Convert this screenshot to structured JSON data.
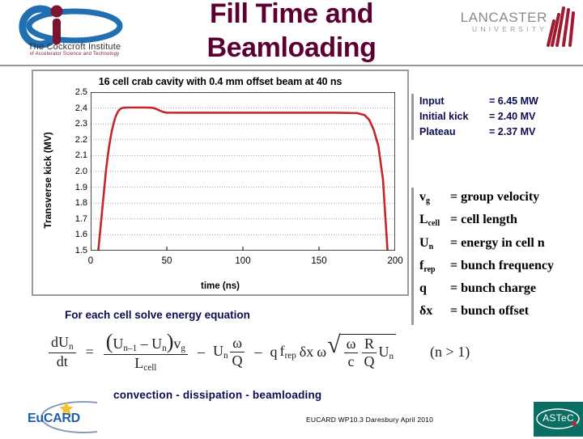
{
  "header": {
    "title": "Fill Time and Beamloading",
    "title_color": "#5C0033",
    "cockcroft": {
      "name": "The Cockcroft Institute",
      "tagline": "of Accelerator Science and Technology"
    },
    "lancaster": {
      "name": "LANCASTER",
      "sub": "UNIVERSITY"
    }
  },
  "chart_data": {
    "type": "line",
    "title": "16 cell crab cavity with 0.4 mm offset beam at 40 ns",
    "xlabel": "time (ns)",
    "ylabel": "Transverse kick (MV)",
    "xlim": [
      0,
      200
    ],
    "ylim": [
      1.5,
      2.5
    ],
    "xticks": [
      "0",
      "50",
      "100",
      "150",
      "200"
    ],
    "xtick_values": [
      0,
      50,
      100,
      150,
      200
    ],
    "yticks": [
      "1.5",
      "1.6",
      "1.7",
      "1.8",
      "1.9",
      "2.0",
      "2.1",
      "2.2",
      "2.3",
      "2.4",
      "2.5"
    ],
    "ytick_values": [
      1.5,
      1.6,
      1.7,
      1.8,
      1.9,
      2.0,
      2.1,
      2.2,
      2.3,
      2.4,
      2.5
    ],
    "grid": true,
    "legend": null,
    "series": [
      {
        "name": "Transverse kick",
        "color": "#C3272B",
        "x": [
          5,
          6,
          7,
          8,
          9,
          10,
          11,
          12,
          13,
          14,
          15,
          16,
          17,
          18,
          19,
          20,
          22,
          25,
          30,
          35,
          40,
          42,
          44,
          46,
          48,
          50,
          60,
          80,
          100,
          120,
          140,
          160,
          175,
          180,
          183,
          186,
          189,
          192,
          195
        ],
        "y": [
          1.5,
          1.6,
          1.7,
          1.8,
          1.9,
          2.0,
          2.08,
          2.15,
          2.21,
          2.26,
          2.3,
          2.335,
          2.36,
          2.378,
          2.39,
          2.398,
          2.402,
          2.403,
          2.403,
          2.403,
          2.402,
          2.398,
          2.39,
          2.381,
          2.374,
          2.371,
          2.37,
          2.37,
          2.37,
          2.37,
          2.37,
          2.37,
          2.368,
          2.355,
          2.325,
          2.26,
          2.16,
          1.95,
          1.5
        ]
      }
    ]
  },
  "results": {
    "rows": [
      {
        "name": "Input",
        "value": "= 6.45 MW"
      },
      {
        "name": "Initial kick",
        "value": "= 2.40 MV"
      },
      {
        "name": "Plateau",
        "value": "= 2.37 MV"
      }
    ]
  },
  "symbols": {
    "rows": [
      {
        "sym": "v",
        "sub": "g",
        "desc": "= group velocity"
      },
      {
        "sym": "L",
        "sub": "cell",
        "desc": "= cell length"
      },
      {
        "sym": "U",
        "sub": "n",
        "desc": "= energy in cell n"
      },
      {
        "sym": "f",
        "sub": "rep",
        "desc": "= bunch frequency"
      },
      {
        "sym": "q",
        "sub": "",
        "desc": "= bunch charge"
      },
      {
        "sym": "δx",
        "sub": "",
        "desc": "= bunch offset"
      }
    ]
  },
  "equation": {
    "solve_label": "For each cell solve energy equation",
    "terms_label": "convection  -  dissipation  -   beamloading",
    "lhs_num": "dU",
    "lhs_num_sub": "n",
    "lhs_den": "dt",
    "equals": "=",
    "num_open": "(",
    "num_u1": "U",
    "num_u1_sub": "n–1",
    "num_minus": "–",
    "num_u2": "U",
    "num_u2_sub": "n",
    "num_close": ")",
    "num_vg": "v",
    "num_vg_sub": "g",
    "den_l": "L",
    "den_l_sub": "cell",
    "minus1": "–",
    "diss_u": "U",
    "diss_u_sub": "n",
    "diss_num": "ω",
    "diss_den": "Q",
    "minus2": "–",
    "bl_q": "q",
    "bl_f": "f",
    "bl_f_sub": "rep",
    "bl_dx": "δx",
    "bl_w": "ω",
    "rad_sign": "√",
    "rad_num1": "ω",
    "rad_den1": "c",
    "rad_num2": "R",
    "rad_den2": "Q",
    "rad_u": "U",
    "rad_u_sub": "n",
    "condition": "(n > 1)"
  },
  "footer": {
    "eucard": "EuCARD",
    "note": "EUCARD WP10.3 Daresbury April 2010",
    "astec": "ASTeC",
    "astec_bg": "#0A6E62"
  }
}
